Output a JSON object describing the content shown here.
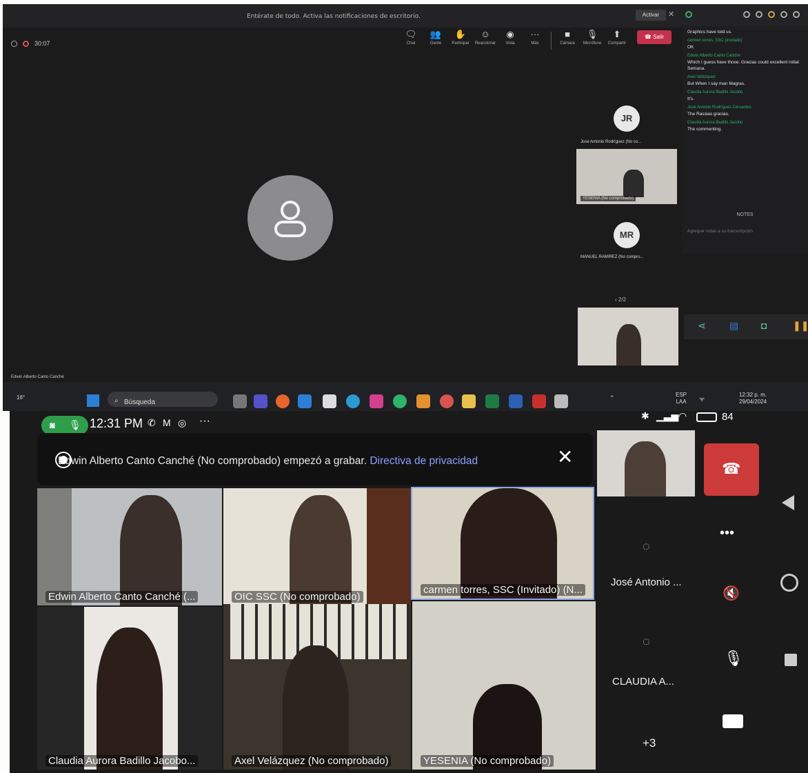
{
  "desktop": {
    "notification": {
      "text": "Entérate de todo. Activa las notificaciones de escritorio.",
      "activate_label": "Activar"
    },
    "call_timer": "30:07",
    "toolbar": {
      "chat": "Chat",
      "people": "Gente",
      "raise": "Participar",
      "react": "Reaccionar",
      "view": "Vista",
      "more": "Más",
      "camera": "Cámara",
      "mic": "Micrófono",
      "share": "Compartir",
      "leave": "Salir"
    },
    "tiles": [
      {
        "initials": "JR",
        "name": "José Antonio Rodríguez (No co..."
      },
      {
        "name": "YESENIA (No comprobado)"
      },
      {
        "initials": "MR",
        "name": "MANUEL RAMIREZ (No compro..."
      }
    ],
    "page_indicator": "2/2",
    "presenter_name": "Edwin Alberto Canto Canché",
    "chat": {
      "messages": [
        {
          "author": "",
          "text": "Graphics have told us."
        },
        {
          "author": "carmen torres, SSC (Invitado)",
          "text": "OK"
        },
        {
          "author": "Edwin Alberto Canto Canché",
          "text": "Which I guess have those. Gracias could excellent initial Semana."
        },
        {
          "author": "Axel Velázquez",
          "text": "But When I say man Magras."
        },
        {
          "author": "Claudia Aurora Badillo Jacobo",
          "text": "It's."
        },
        {
          "author": "José Antonio Rodríguez Cervantes",
          "text": "The Rassias gracias."
        },
        {
          "author": "Claudia Aurora Badillo Jacobo",
          "text": "The commenting."
        }
      ],
      "notes_header": "NOTES",
      "notes_placeholder": "Agregue notas a su transcripción"
    },
    "taskbar": {
      "temperature": "16°",
      "search_label": "Búsqueda",
      "lang_line1": "ESP",
      "lang_line2": "LAA",
      "time": "12:32 p. m.",
      "date": "29/04/2024"
    }
  },
  "mobile": {
    "status": {
      "time": "12:31 PM",
      "battery": "84",
      "more": "···"
    },
    "banner": {
      "text": "Edwin Alberto Canto Canché (No comprobado) empezó a grabar.",
      "link": "Directiva de privacidad"
    },
    "tiles": [
      {
        "name": "Edwin Alberto Canto Canché (... "
      },
      {
        "name": "OIC SSC (No comprobado)"
      },
      {
        "name": "carmen torres, SSC (Invitado) (N..."
      },
      {
        "name": "Claudia Aurora Badillo Jacobo..."
      },
      {
        "name": "Axel Velázquez (No comprobado)"
      },
      {
        "name": "YESENIA (No comprobado)"
      }
    ],
    "side": {
      "person1": "José Antonio ...",
      "person2": "CLAUDIA A...",
      "more_count": "+3"
    }
  }
}
